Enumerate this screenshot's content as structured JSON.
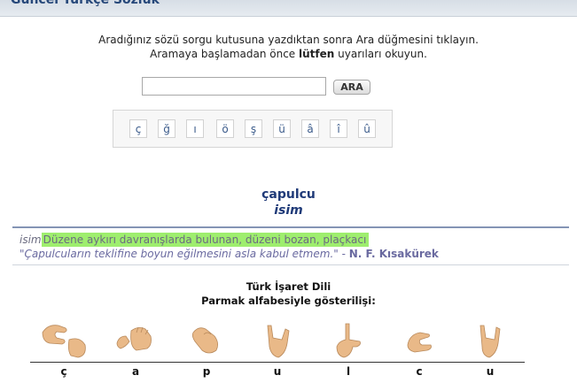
{
  "header": {
    "title": "Güncel Türkçe Sözlük"
  },
  "search": {
    "instruction_line1": "Aradığınız sözü sorgu kutusuna yazdıktan sonra Ara düğmesini tıklayın.",
    "instruction_line2_before": "Aramaya başlamadan önce ",
    "instruction_line2_bold": "lütfen",
    "instruction_line2_after": " uyarıları okuyun.",
    "input_value": "",
    "button_label": "ARA"
  },
  "special_chars": [
    "ç",
    "ğ",
    "ı",
    "ö",
    "ş",
    "ü",
    "â",
    "î",
    "û"
  ],
  "result": {
    "word": "çapulcu",
    "word_type": "isim",
    "definition_type": "isim",
    "definition": "Düzene aykırı davranışlarda bulunan, düzeni bozan, plaçkacı",
    "highlight_color": "#9eee6e",
    "quote": "\"Çapulcuların teklifine boyun eğilmesini asla kabul etmem.\"",
    "quote_separator": " - ",
    "quote_author": "N. F. Kısakürek"
  },
  "sign_language": {
    "title": "Türk İşaret Dili",
    "subtitle": "Parmak alfabesiyle gösterilişi:",
    "letters": [
      "ç",
      "a",
      "p",
      "u",
      "l",
      "c",
      "u"
    ],
    "hand_icons": [
      "hand-sign-c-cedilla-icon",
      "hand-sign-a-icon",
      "hand-sign-p-icon",
      "hand-sign-u-icon",
      "hand-sign-l-icon",
      "hand-sign-c-icon",
      "hand-sign-u-icon"
    ],
    "skin_color": "#e9b988"
  },
  "colors": {
    "title_blue": "#1f3a78",
    "header_bar": "#d7dee6",
    "rule_blue": "#8494b5"
  }
}
